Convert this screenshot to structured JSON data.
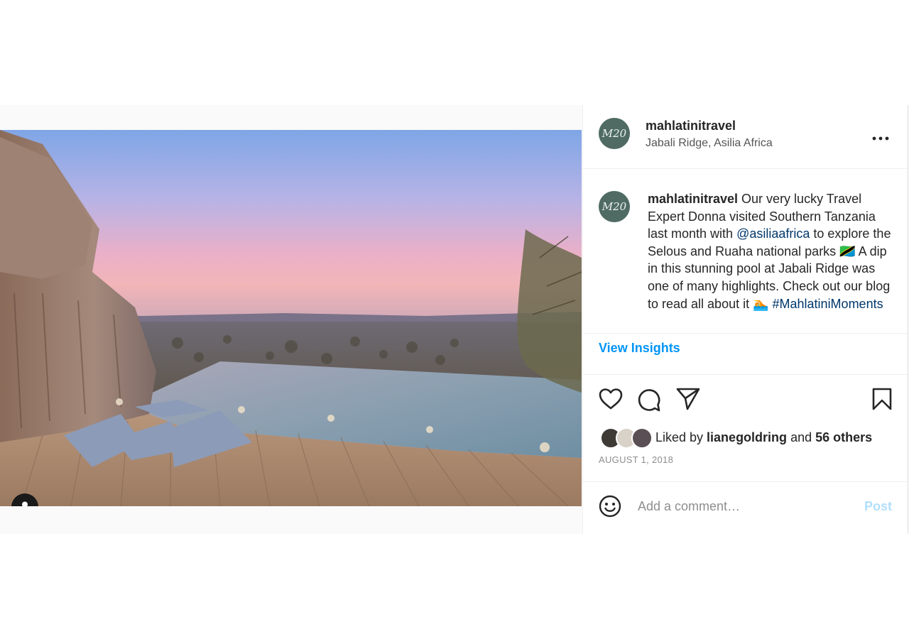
{
  "post": {
    "username": "mahlatinitravel",
    "location": "Jabali Ridge, Asilia Africa",
    "avatar_text": "M20",
    "more_icon": "more-horizontal-icon"
  },
  "caption": {
    "username": "mahlatinitravel",
    "text_part1": " Our very lucky Travel Expert Donna visited Southern Tanzania last month with ",
    "mention": "@asiliaafrica",
    "text_part2": " to explore the Selous and Ruaha national parks 🇹🇿 A dip in this stunning pool at Jabali Ridge was one of many highlights. Check out our blog to read all about it 🏊 ",
    "hashtag": "#MahlatiniMoments"
  },
  "insights": {
    "label": "View Insights"
  },
  "actions": {
    "icons": [
      "heart-icon",
      "comment-icon",
      "share-icon",
      "bookmark-icon"
    ]
  },
  "likes": {
    "prefix": "Liked by ",
    "user": "lianegoldring",
    "middle": " and ",
    "others": "56 others"
  },
  "date": "AUGUST 1, 2018",
  "comment_box": {
    "placeholder": "Add a comment…",
    "post_label": "Post"
  },
  "colors": {
    "link": "#00376b",
    "accent": "#0095f6",
    "post_disabled": "#b2dffc",
    "avatar_bg": "#4f6b63"
  }
}
